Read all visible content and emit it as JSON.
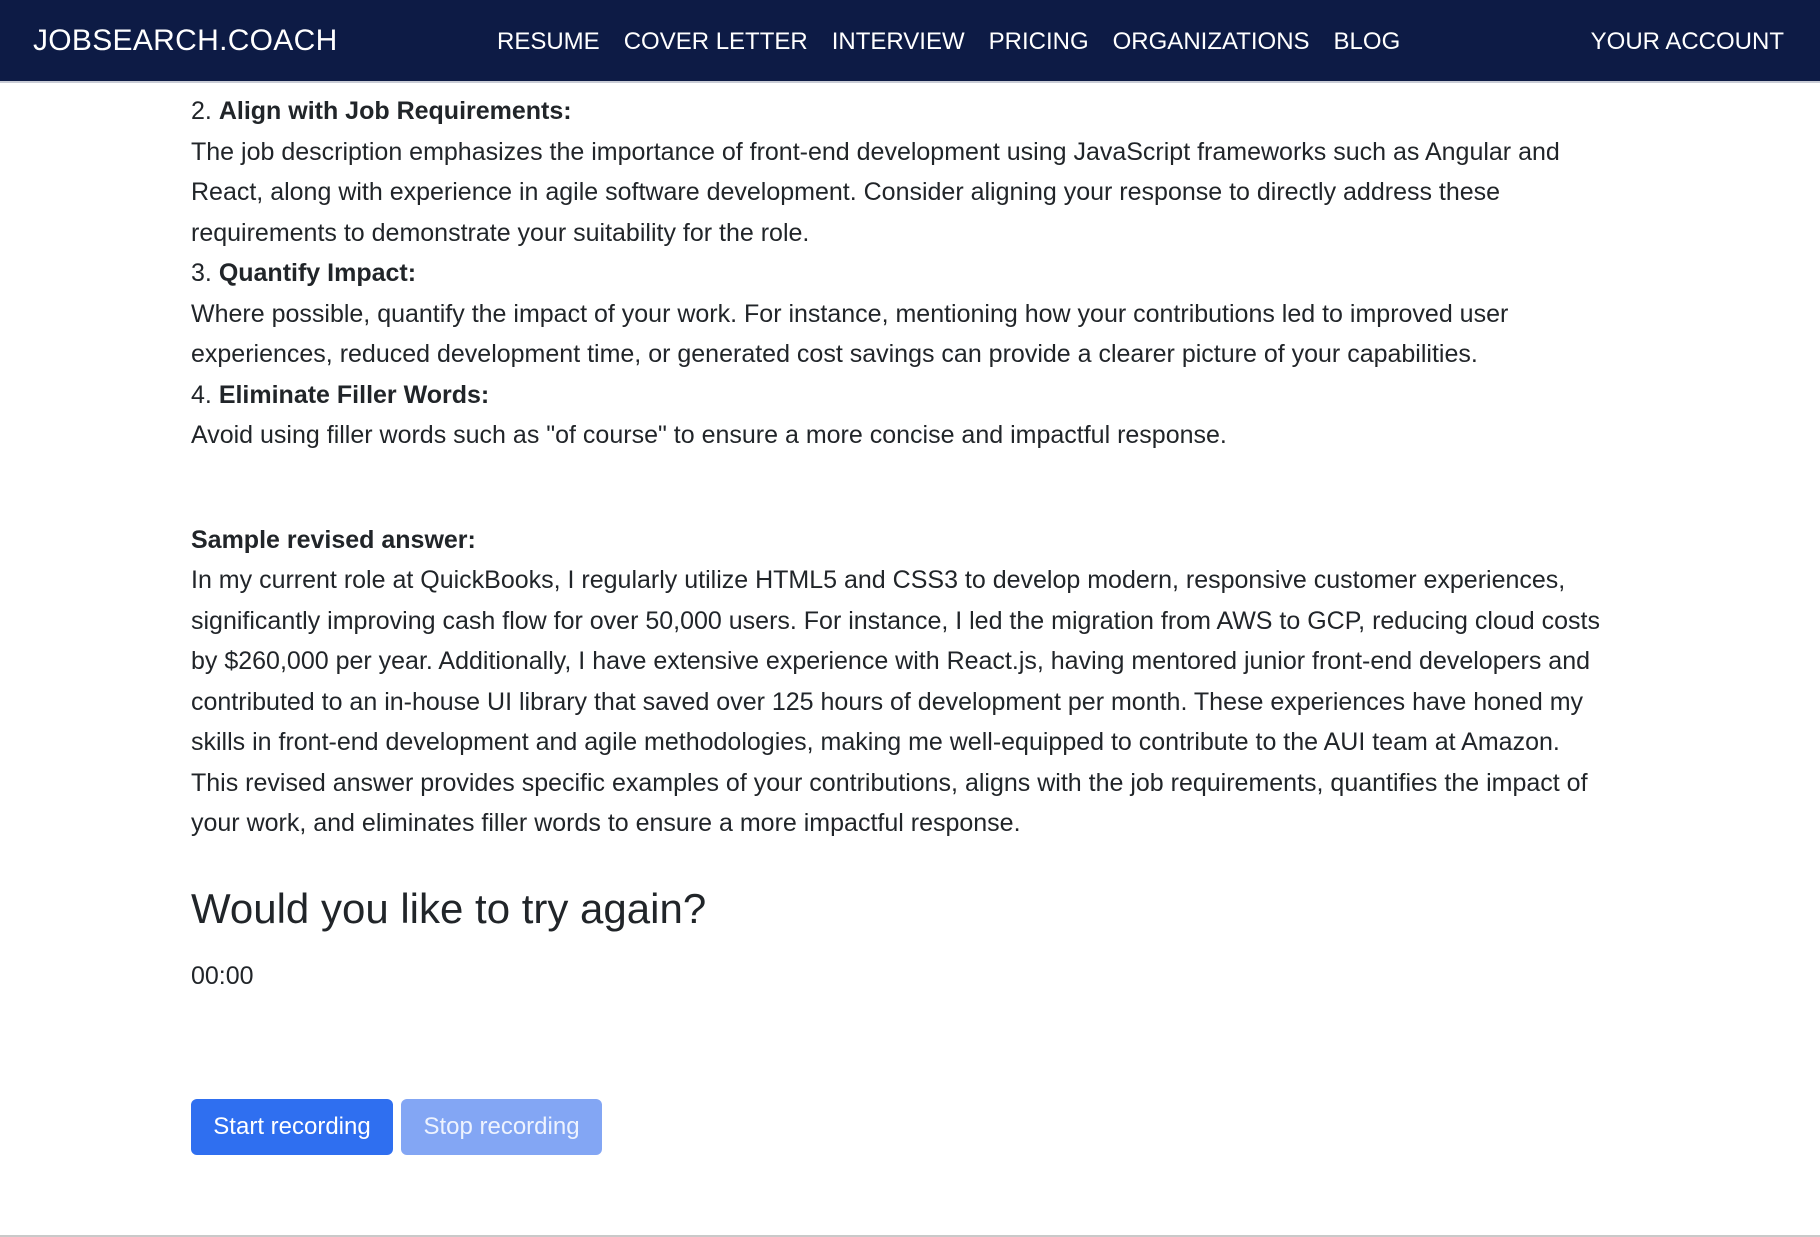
{
  "nav": {
    "brand": "JOBSEARCH.COACH",
    "links": [
      "RESUME",
      "COVER LETTER",
      "INTERVIEW",
      "PRICING",
      "ORGANIZATIONS",
      "BLOG"
    ],
    "account": "YOUR ACCOUNT"
  },
  "feedback": {
    "items": [
      {
        "number": "2.",
        "title": "Align with Job Requirements:",
        "body": "The job description emphasizes the importance of front-end development using JavaScript frameworks such as Angular and React, along with experience in agile software development. Consider aligning your response to directly address these requirements to demonstrate your suitability for the role."
      },
      {
        "number": "3.",
        "title": "Quantify Impact:",
        "body": "Where possible, quantify the impact of your work. For instance, mentioning how your contributions led to improved user experiences, reduced development time, or generated cost savings can provide a clearer picture of your capabilities."
      },
      {
        "number": "4.",
        "title": "Eliminate Filler Words:",
        "body": "Avoid using filler words such as \"of course\" to ensure a more concise and impactful response."
      }
    ],
    "sample_heading": "Sample revised answer:",
    "sample_body": "In my current role at QuickBooks, I regularly utilize HTML5 and CSS3 to develop modern, responsive customer experiences, significantly improving cash flow for over 50,000 users. For instance, I led the migration from AWS to GCP, reducing cloud costs by $260,000 per year. Additionally, I have extensive experience with React.js, having mentored junior front-end developers and contributed to an in-house UI library that saved over 125 hours of development per month. These experiences have honed my skills in front-end development and agile methodologies, making me well-equipped to contribute to the AUI team at Amazon.",
    "summary": "This revised answer provides specific examples of your contributions, aligns with the job requirements, quantifies the impact of your work, and eliminates filler words to ensure a more impactful response."
  },
  "retry": {
    "heading": "Would you like to try again?",
    "timer": "00:00",
    "start_label": "Start recording",
    "stop_label": "Stop recording"
  }
}
